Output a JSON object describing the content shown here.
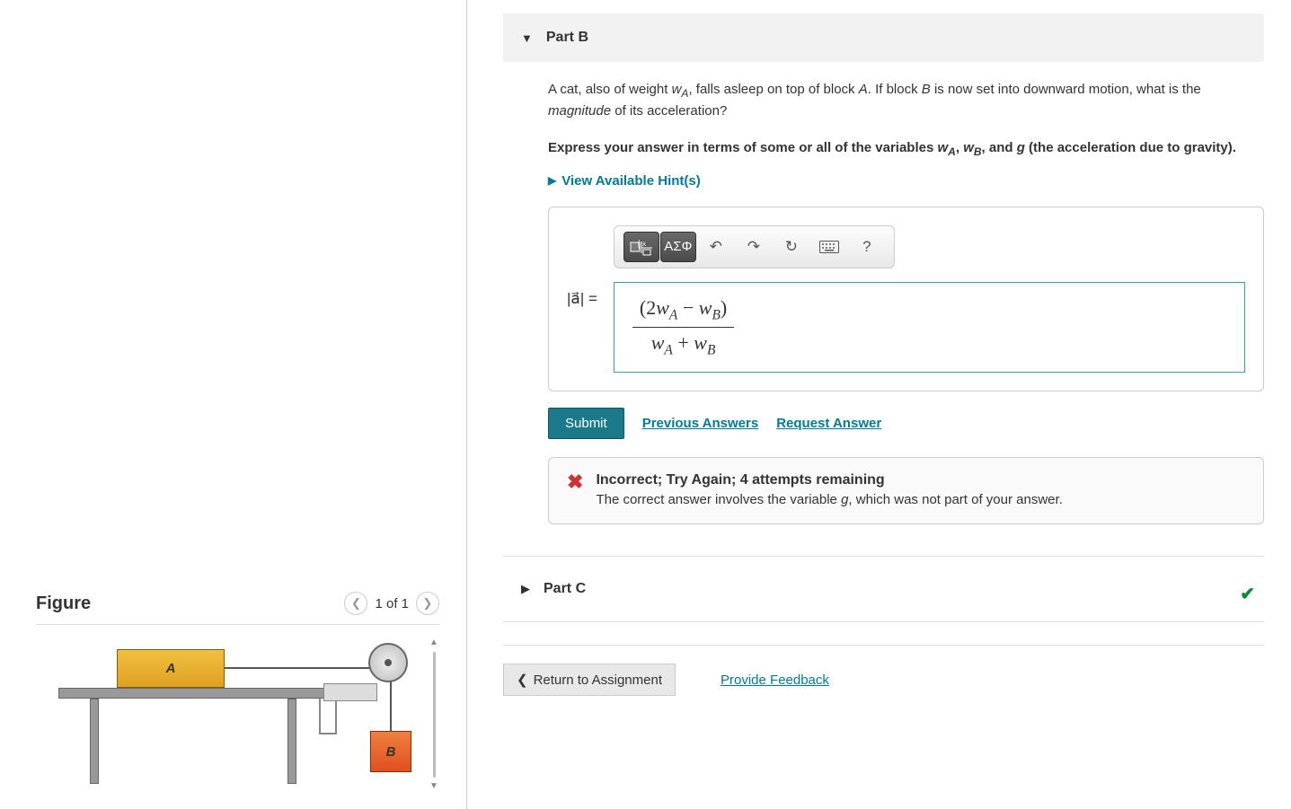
{
  "figure": {
    "title": "Figure",
    "counter": "1 of 1",
    "blockA": "A",
    "blockB": "B"
  },
  "partB": {
    "title": "Part B",
    "question_pre": "A cat, also of weight ",
    "wA": "w",
    "wA_sub": "A",
    "question_mid": ", falls asleep on top of block ",
    "blockA_ref": "A",
    "question_mid2": ". If block ",
    "blockB_ref": "B",
    "question_end": " is now set into downward motion, what is the ",
    "magnitude": "magnitude",
    "question_end2": " of its acceleration?",
    "instr_pre": "Express your answer in terms of some or all of the variables ",
    "instr_wA": "w",
    "instr_wA_sub": "A",
    "instr_comma": ", ",
    "instr_wB": "w",
    "instr_wB_sub": "B",
    "instr_mid": ", and ",
    "instr_g": "g",
    "instr_end": " (the acceleration due to gravity).",
    "hints_label": "View Available Hint(s)",
    "ans_label": "|a⃗| =",
    "toolbar_greek": "ΑΣΦ",
    "formula": {
      "num_pre": "(2",
      "wA": "w",
      "wA_s": "A",
      "minus": " − ",
      "wB": "w",
      "wB_s": "B",
      "num_post": ")",
      "den_wA": "w",
      "den_wA_s": "A",
      "plus": " + ",
      "den_wB": "w",
      "den_wB_s": "B"
    },
    "submit": "Submit",
    "prev_answers": "Previous Answers",
    "req_answer": "Request Answer",
    "feedback_title": "Incorrect; Try Again; 4 attempts remaining",
    "feedback_msg_pre": "The correct answer involves the variable ",
    "feedback_g": "g",
    "feedback_msg_post": ", which was not part of your answer."
  },
  "partC": {
    "title": "Part C"
  },
  "footer": {
    "return": "Return to Assignment",
    "feedback": "Provide Feedback"
  }
}
